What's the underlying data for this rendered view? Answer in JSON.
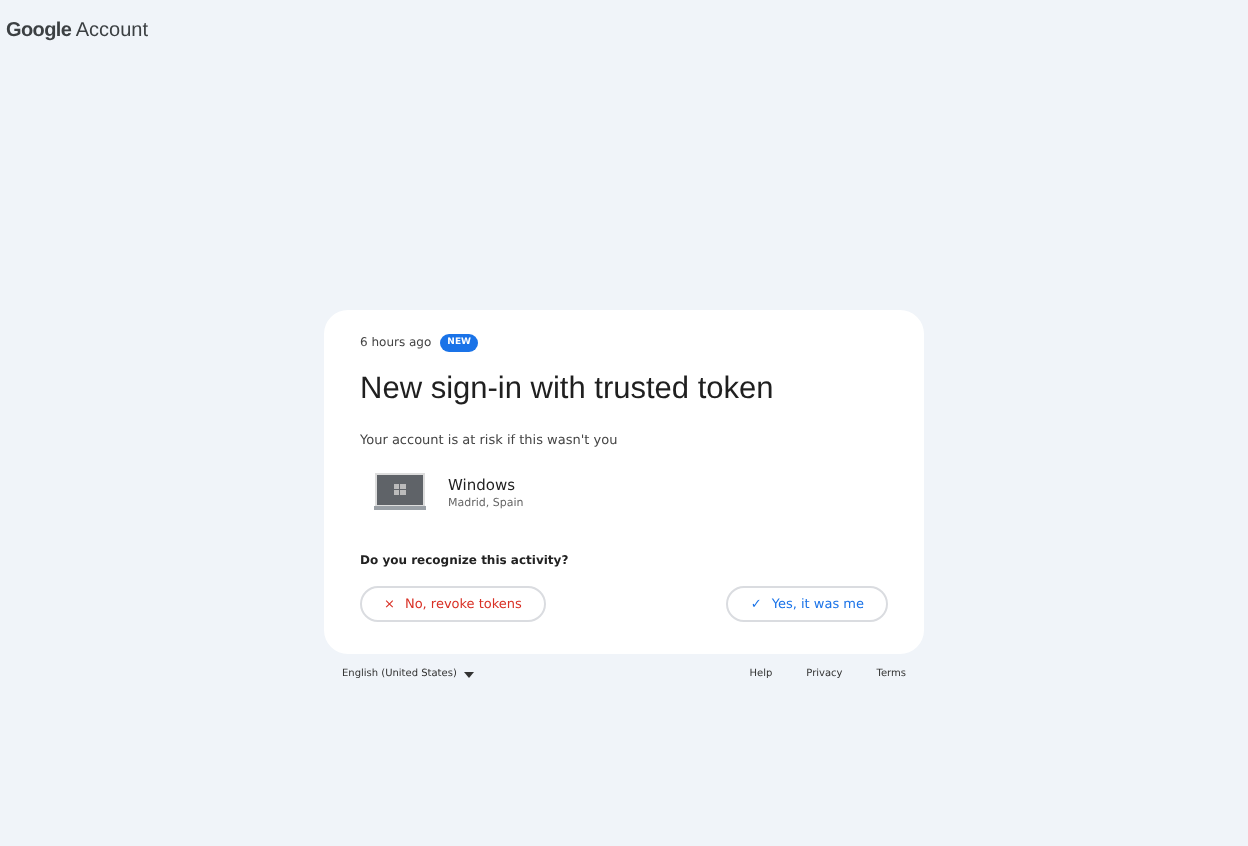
{
  "header": {
    "brand": "Google",
    "product": "Account"
  },
  "card": {
    "time": "6 hours ago",
    "badge": "NEW",
    "title": "New sign-in with trusted token",
    "subtitle": "Your account is at risk if this wasn't you",
    "device": {
      "name": "Windows",
      "location": "Madrid, Spain"
    },
    "question": "Do you recognize this activity?",
    "buttons": [
      {
        "kind": "deny",
        "icon": "×",
        "label": "No, revoke tokens"
      },
      {
        "kind": "confirm",
        "icon": "✓",
        "label": "Yes, it was me"
      }
    ]
  },
  "footer": {
    "language": "English (United States)",
    "links": [
      "Help",
      "Privacy",
      "Terms"
    ]
  }
}
